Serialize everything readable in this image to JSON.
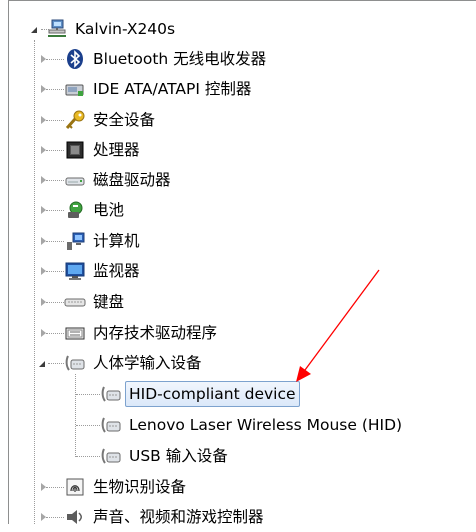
{
  "tree": {
    "root": {
      "label": "Kalvin-X240s"
    },
    "items": [
      {
        "label": "Bluetooth 无线电收发器"
      },
      {
        "label": "IDE ATA/ATAPI 控制器"
      },
      {
        "label": "安全设备"
      },
      {
        "label": "处理器"
      },
      {
        "label": "磁盘驱动器"
      },
      {
        "label": "电池"
      },
      {
        "label": "计算机"
      },
      {
        "label": "监视器"
      },
      {
        "label": "键盘"
      },
      {
        "label": "内存技术驱动程序"
      },
      {
        "label": "人体学输入设备",
        "children": [
          {
            "label": "HID-compliant device",
            "selected": true
          },
          {
            "label": "Lenovo Laser Wireless Mouse (HID)"
          },
          {
            "label": "USB 输入设备"
          }
        ]
      },
      {
        "label": "生物识别设备"
      },
      {
        "label": "声音、视频和游戏控制器"
      }
    ]
  },
  "annotation": {
    "arrow_color": "#ff0000"
  }
}
